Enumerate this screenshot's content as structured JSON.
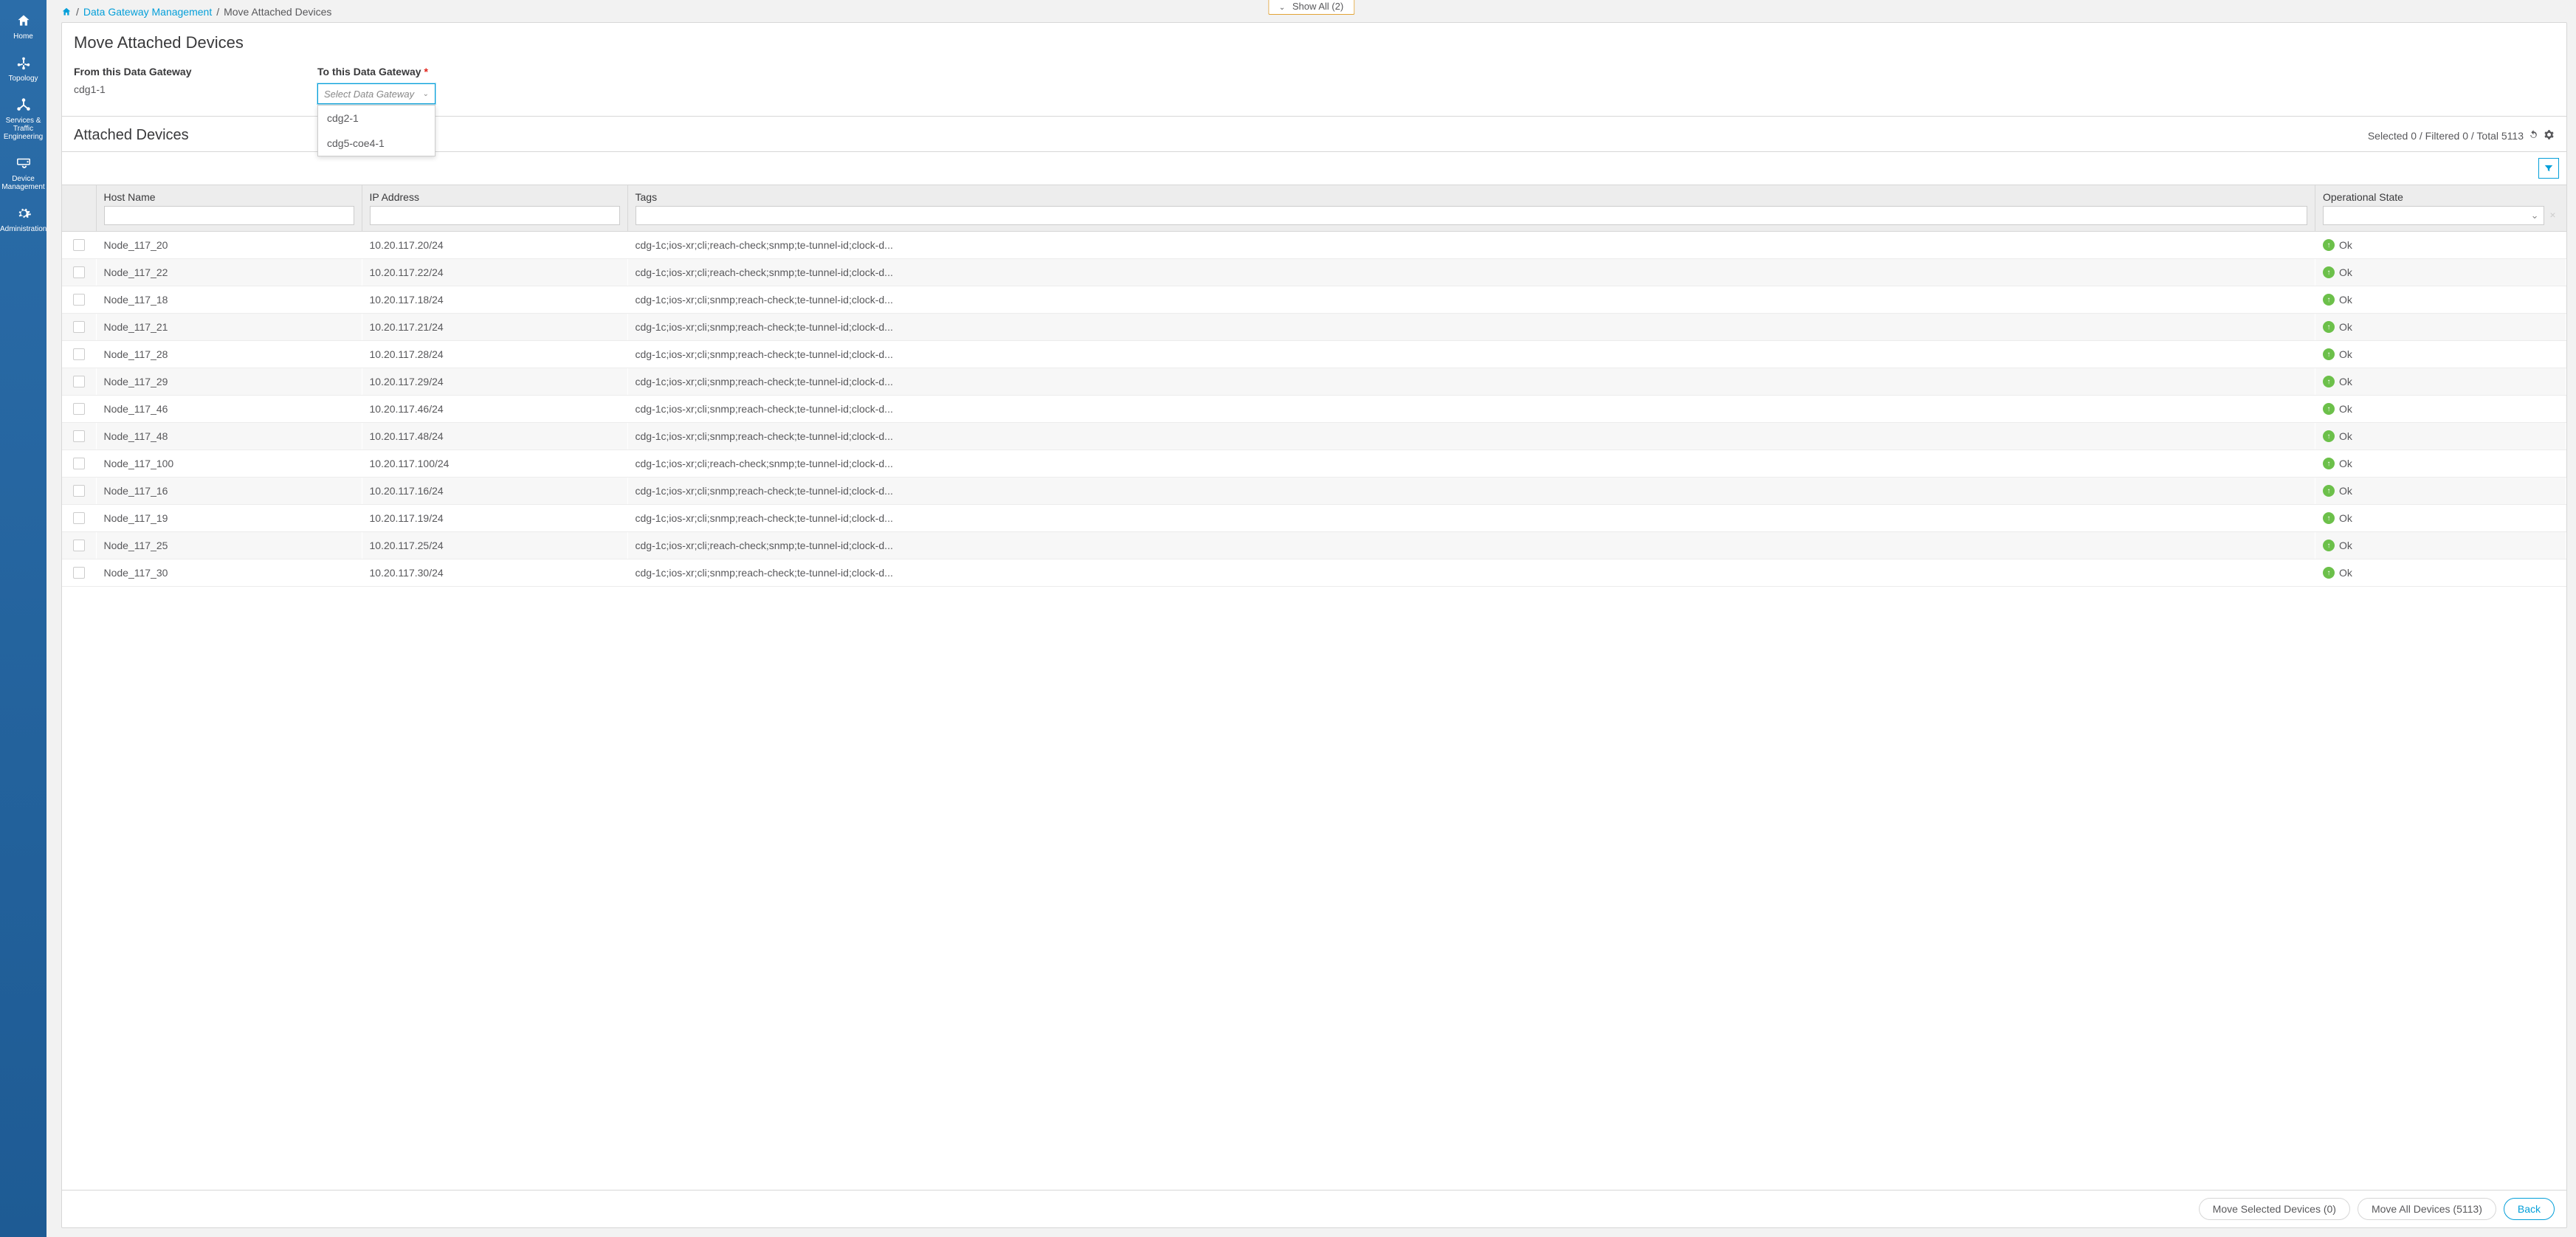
{
  "sidebar": {
    "items": [
      {
        "label": "Home"
      },
      {
        "label": "Topology"
      },
      {
        "label": "Services & Traffic Engineering"
      },
      {
        "label": "Device Management"
      },
      {
        "label": "Administration"
      }
    ]
  },
  "show_all": {
    "label": "Show All (2)"
  },
  "breadcrumb": {
    "link1": "Data Gateway Management",
    "current": "Move Attached Devices"
  },
  "page": {
    "title": "Move Attached Devices",
    "from_label": "From this Data Gateway",
    "from_value": "cdg1-1",
    "to_label": "To this Data Gateway",
    "select_placeholder": "Select Data Gateway",
    "dropdown_options": [
      "cdg2-1",
      "cdg5-coe4-1"
    ]
  },
  "attached": {
    "title": "Attached Devices",
    "stats": "Selected 0 / Filtered 0 / Total 5113"
  },
  "columns": {
    "host": "Host Name",
    "ip": "IP Address",
    "tags": "Tags",
    "op": "Operational State"
  },
  "rows": [
    {
      "host": "Node_117_20",
      "ip": "10.20.117.20/24",
      "tags": "cdg-1c;ios-xr;cli;reach-check;snmp;te-tunnel-id;clock-d...",
      "op": "Ok"
    },
    {
      "host": "Node_117_22",
      "ip": "10.20.117.22/24",
      "tags": "cdg-1c;ios-xr;cli;reach-check;snmp;te-tunnel-id;clock-d...",
      "op": "Ok"
    },
    {
      "host": "Node_117_18",
      "ip": "10.20.117.18/24",
      "tags": "cdg-1c;ios-xr;cli;snmp;reach-check;te-tunnel-id;clock-d...",
      "op": "Ok"
    },
    {
      "host": "Node_117_21",
      "ip": "10.20.117.21/24",
      "tags": "cdg-1c;ios-xr;cli;snmp;reach-check;te-tunnel-id;clock-d...",
      "op": "Ok"
    },
    {
      "host": "Node_117_28",
      "ip": "10.20.117.28/24",
      "tags": "cdg-1c;ios-xr;cli;snmp;reach-check;te-tunnel-id;clock-d...",
      "op": "Ok"
    },
    {
      "host": "Node_117_29",
      "ip": "10.20.117.29/24",
      "tags": "cdg-1c;ios-xr;cli;snmp;reach-check;te-tunnel-id;clock-d...",
      "op": "Ok"
    },
    {
      "host": "Node_117_46",
      "ip": "10.20.117.46/24",
      "tags": "cdg-1c;ios-xr;cli;snmp;reach-check;te-tunnel-id;clock-d...",
      "op": "Ok"
    },
    {
      "host": "Node_117_48",
      "ip": "10.20.117.48/24",
      "tags": "cdg-1c;ios-xr;cli;snmp;reach-check;te-tunnel-id;clock-d...",
      "op": "Ok"
    },
    {
      "host": "Node_117_100",
      "ip": "10.20.117.100/24",
      "tags": "cdg-1c;ios-xr;cli;reach-check;snmp;te-tunnel-id;clock-d...",
      "op": "Ok"
    },
    {
      "host": "Node_117_16",
      "ip": "10.20.117.16/24",
      "tags": "cdg-1c;ios-xr;cli;snmp;reach-check;te-tunnel-id;clock-d...",
      "op": "Ok"
    },
    {
      "host": "Node_117_19",
      "ip": "10.20.117.19/24",
      "tags": "cdg-1c;ios-xr;cli;snmp;reach-check;te-tunnel-id;clock-d...",
      "op": "Ok"
    },
    {
      "host": "Node_117_25",
      "ip": "10.20.117.25/24",
      "tags": "cdg-1c;ios-xr;cli;reach-check;snmp;te-tunnel-id;clock-d...",
      "op": "Ok"
    },
    {
      "host": "Node_117_30",
      "ip": "10.20.117.30/24",
      "tags": "cdg-1c;ios-xr;cli;snmp;reach-check;te-tunnel-id;clock-d...",
      "op": "Ok"
    }
  ],
  "footer": {
    "move_selected": "Move Selected Devices (0)",
    "move_all": "Move All Devices (5113)",
    "back": "Back"
  }
}
